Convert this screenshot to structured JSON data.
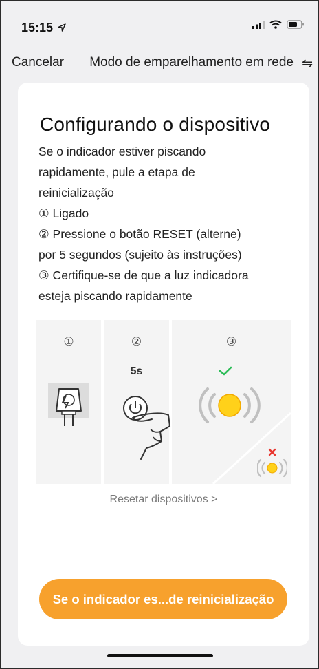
{
  "status": {
    "time": "15:15"
  },
  "nav": {
    "cancel": "Cancelar",
    "title": "Modo de emparelhamento em rede"
  },
  "card": {
    "title": "Configurando o dispositivo",
    "desc_lines": [
      "Se o indicador estiver piscando",
      "rapidamente, pule a etapa de",
      "reinicialização",
      "① Ligado",
      "② Pressione o botão RESET   (alterne)",
      "por 5 segundos (sujeito às instruções)",
      "③ Certifique-se de que a luz indicadora",
      "esteja piscando rapidamente"
    ],
    "steps": [
      {
        "num": "①"
      },
      {
        "num": "②",
        "duration": "5s"
      },
      {
        "num": "③"
      }
    ],
    "reset_link": "Resetar dispositivos >",
    "cta": "Se o indicador es...de reinicialização"
  },
  "colors": {
    "accent": "#f7a12d",
    "check": "#2ebd59",
    "error": "#e8352e",
    "light": "#ffd11a"
  },
  "icons": [
    "arrow-icon",
    "signal-icon",
    "wifi-icon",
    "battery-icon",
    "swap-icon",
    "power-plug-icon",
    "power-button-icon",
    "hand-icon",
    "check-icon",
    "blinking-light-icon",
    "x-icon"
  ]
}
